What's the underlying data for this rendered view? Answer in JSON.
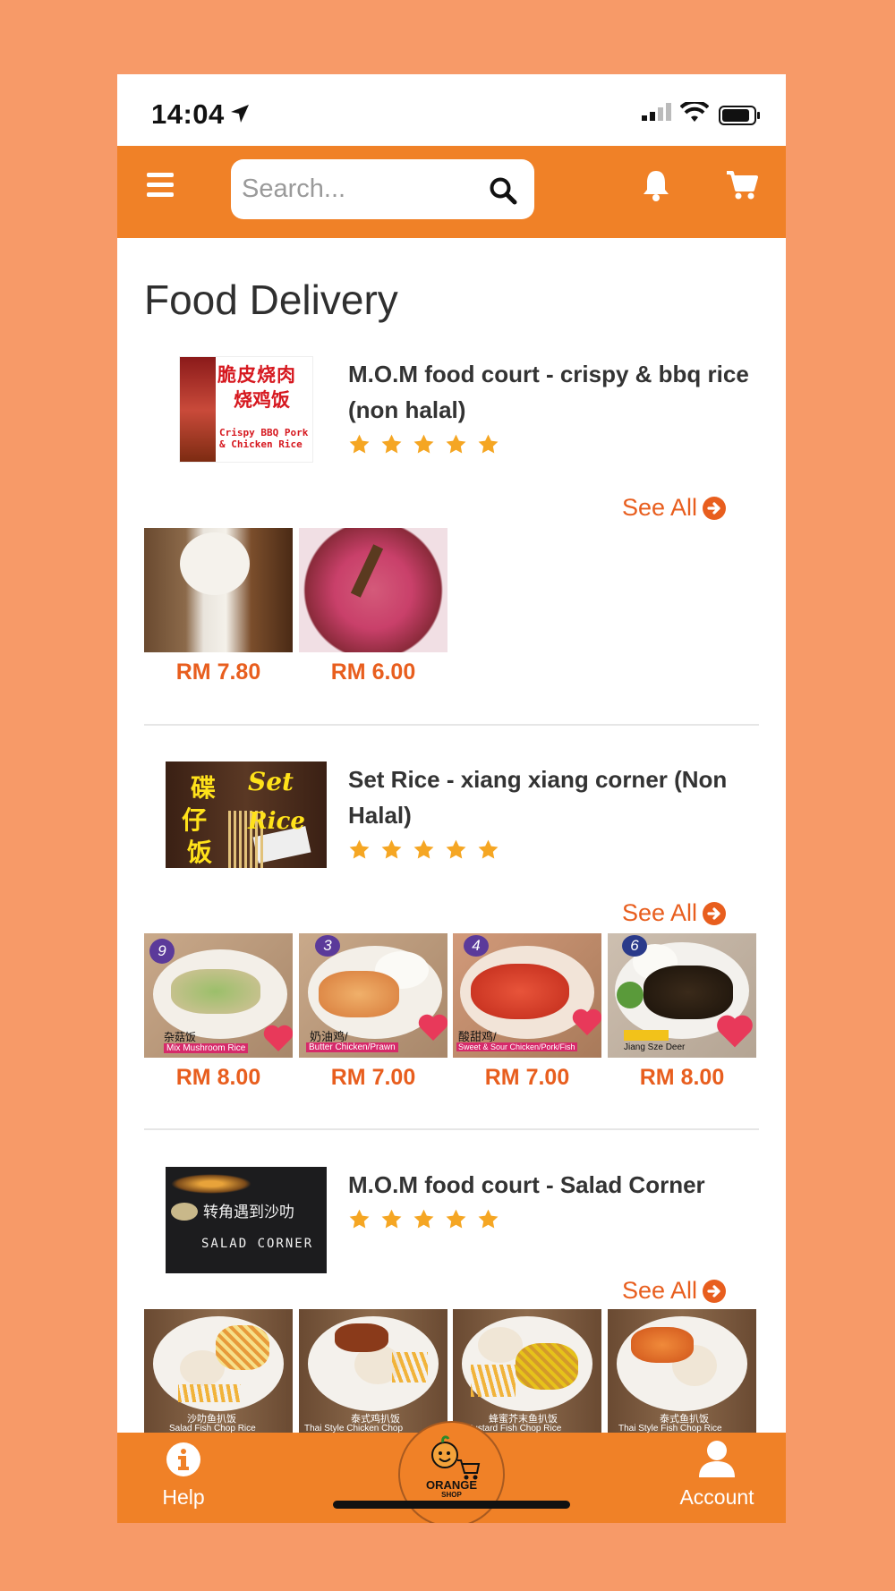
{
  "status": {
    "time": "14:04"
  },
  "search": {
    "placeholder": "Search..."
  },
  "page": {
    "title": "Food Delivery"
  },
  "shops": [
    {
      "name": "M.O.M food court - crispy & bbq rice (non halal)",
      "logo_text": [
        "脆皮烧肉",
        "烧鸡饭",
        "Crispy BBQ Pork",
        "& Chicken Rice"
      ],
      "rating": 5,
      "see_all": "See All",
      "items": [
        {
          "price": "RM 7.80"
        },
        {
          "price": "RM 6.00"
        }
      ]
    },
    {
      "name": "Set Rice - xiang xiang corner (Non Halal)",
      "logo_text": [
        "碟",
        "仔",
        "饭",
        "Set",
        "Rice"
      ],
      "rating": 5,
      "see_all": "See All",
      "items": [
        {
          "price": "RM 8.00",
          "number": "9",
          "caption_cn": "杂菇饭",
          "caption_en": "Mix Mushroom Rice"
        },
        {
          "price": "RM 7.00",
          "number": "3",
          "caption_cn": "奶油鸡/",
          "caption_en": "Butter Chicken/Prawn"
        },
        {
          "price": "RM 7.00",
          "number": "4",
          "caption_cn": "酸甜鸡/",
          "caption_en": "Sweet & Sour Chicken/Pork/Fish"
        },
        {
          "price": "RM 8.00",
          "number": "6",
          "caption_cn": "",
          "caption_en": "Jiang Sze Deer"
        }
      ]
    },
    {
      "name": "M.O.M food court - Salad Corner",
      "logo_text": [
        "转角遇到沙叻",
        "SALAD CORNER"
      ],
      "rating": 5,
      "see_all": "See All",
      "items": [
        {
          "caption_cn": "沙叻鱼扒饭",
          "caption_en": "Salad Fish Chop Rice"
        },
        {
          "caption_cn": "泰式鸡扒饭",
          "caption_en": "Thai Style Chicken Chop"
        },
        {
          "caption_cn": "蜂蜜芥末鱼扒饭",
          "caption_en": "Mustard Fish Chop Rice"
        },
        {
          "caption_cn": "泰式鱼扒饭",
          "caption_en": "Thai Style Fish Chop Rice"
        }
      ]
    }
  ],
  "bottom_nav": {
    "help": "Help",
    "account": "Account",
    "brand": [
      "ORANGE",
      "SHOP"
    ]
  },
  "colors": {
    "accent": "#F08127",
    "price": "#E85E1E",
    "star": "#F5A623",
    "background": "#F79A68"
  },
  "icons": [
    "location-arrow-icon",
    "signal-icon",
    "wifi-icon",
    "battery-icon",
    "menu-icon",
    "search-icon",
    "bell-icon",
    "cart-icon",
    "star-icon",
    "arrow-circle-right-icon",
    "info-icon",
    "user-icon",
    "orange-mascot-icon"
  ]
}
